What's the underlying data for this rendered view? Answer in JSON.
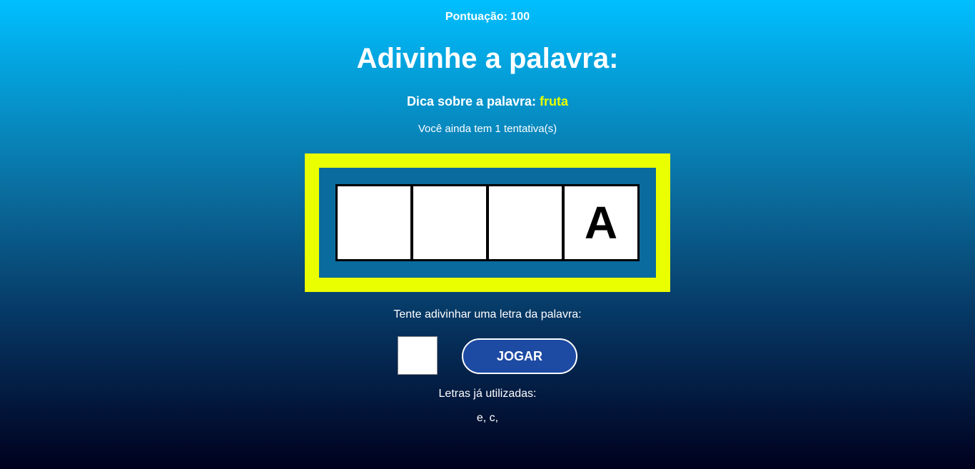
{
  "score": {
    "label": "Pontuação: 100"
  },
  "title": "Adivinhe a palavra:",
  "hint": {
    "label": "Dica sobre a palavra:",
    "value": "fruta"
  },
  "attempts_text": "Você ainda tem 1 tentativa(s)",
  "word_tiles": [
    "",
    "",
    "",
    "A"
  ],
  "guess": {
    "prompt": "Tente adivinhar uma letra da palavra:",
    "input_value": "",
    "button_label": "JOGAR"
  },
  "used_letters": {
    "label": "Letras já utilizadas:",
    "value": "e, c,"
  },
  "colors": {
    "accent_yellow": "#eaff00",
    "button_blue": "#1d4aa3",
    "board_blue": "#0a6b9e"
  }
}
